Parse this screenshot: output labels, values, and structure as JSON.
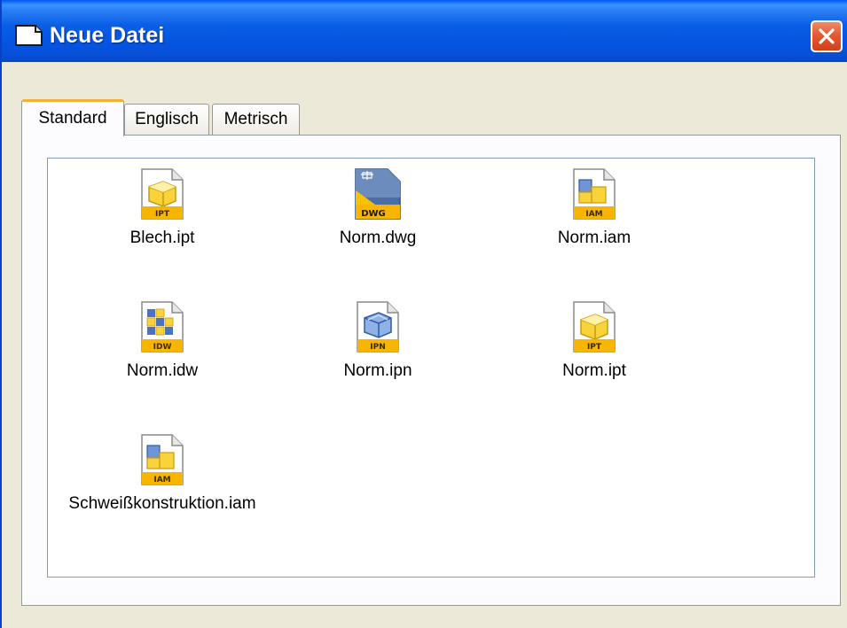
{
  "window": {
    "title": "Neue Datei",
    "close_label": "×"
  },
  "tabs": [
    {
      "label": "Standard",
      "active": true
    },
    {
      "label": "Englisch",
      "active": false
    },
    {
      "label": "Metrisch",
      "active": false
    }
  ],
  "files": [
    {
      "name": "Blech.ipt",
      "icon": "ipt-part-icon",
      "badge": "IPT"
    },
    {
      "name": "Norm.dwg",
      "icon": "dwg-drawing-icon",
      "badge": "DWG"
    },
    {
      "name": "Norm.iam",
      "icon": "iam-assembly-icon",
      "badge": "IAM"
    },
    {
      "name": "Norm.idw",
      "icon": "idw-drawing-icon",
      "badge": "IDW"
    },
    {
      "name": "Norm.ipn",
      "icon": "ipn-presentation-icon",
      "badge": "IPN"
    },
    {
      "name": "Norm.ipt",
      "icon": "ipt-part-icon",
      "badge": "IPT"
    },
    {
      "name": "Schweißkonstruktion.iam",
      "icon": "iam-assembly-icon",
      "badge": "IAM"
    }
  ],
  "colors": {
    "titlebar": "#0554e0",
    "active_tab_accent": "#f3b13c",
    "icon_badge": "#f7b500",
    "close_button": "#e45a32"
  }
}
